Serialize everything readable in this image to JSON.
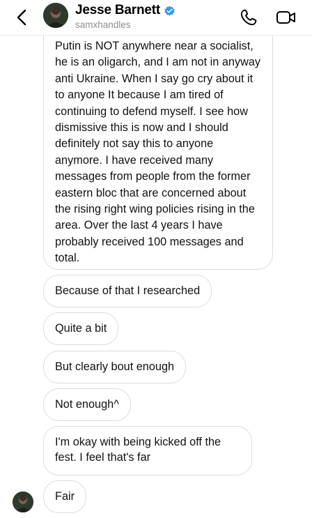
{
  "header": {
    "contact_name": "Jesse Barnett",
    "handle": "samxhandles"
  },
  "messages": [
    {
      "text": "Putin is NOT anywhere near a socialist, he is an oligarch, and I am not in anyway anti Ukraine. When I say go cry about it to anyone It because I am tired of continuing to defend myself. I see how dismissive this is now and I should definitely not say this to anyone anymore. I have received many messages from people from the former eastern bloc that are concerned about the rising right wing policies rising in the area. Over the last 4 years I have probably received 100 messages and total."
    },
    {
      "text": "Because of that I researched"
    },
    {
      "text": "Quite a bit"
    },
    {
      "text": "But clearly bout enough"
    },
    {
      "text": "Not enough^"
    },
    {
      "text": "I'm okay with being kicked off the fest. I feel that's far"
    },
    {
      "text": "Fair"
    }
  ],
  "colors": {
    "bubble_border": "#dbdbdb",
    "verified_badge": "#3897f0",
    "secondary_text": "#8e8e8e"
  },
  "icons": {
    "back": "chevron-left-icon",
    "verified": "verified-badge-icon",
    "call": "phone-icon",
    "video": "video-camera-icon"
  }
}
